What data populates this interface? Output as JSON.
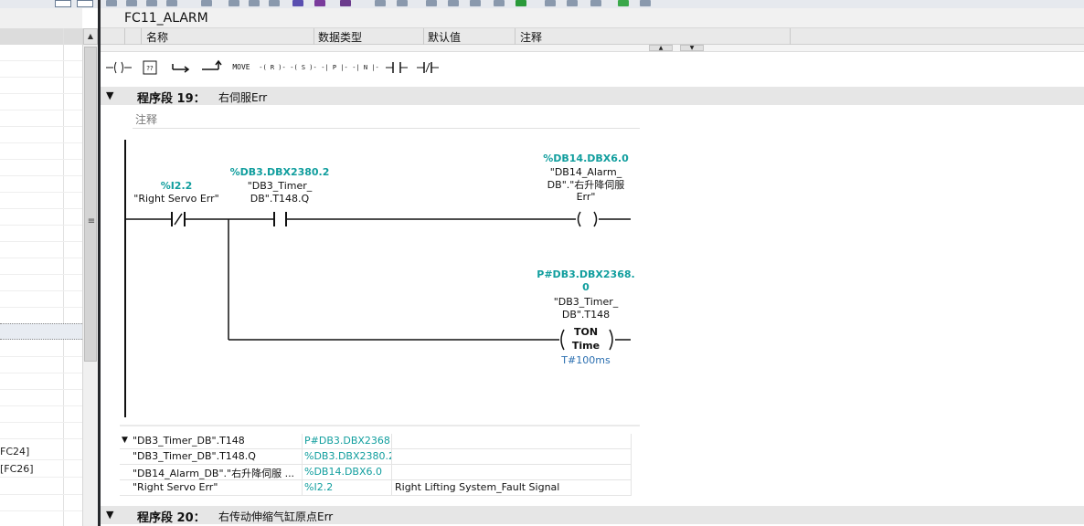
{
  "left_tree": {
    "items": [
      {
        "label": ""
      },
      {
        "label": ""
      },
      {
        "label": "FC24]"
      },
      {
        "label": "[FC26]"
      }
    ]
  },
  "block": {
    "title": "FC11_ALARM"
  },
  "interface": {
    "columns": [
      "名称",
      "数据类型",
      "默认值",
      "注释"
    ]
  },
  "palette": {
    "items": [
      {
        "icon": "coil-icon",
        "glyph": "—( )—"
      },
      {
        "icon": "empty-box-icon",
        "glyph": "??"
      },
      {
        "icon": "open-branch-icon",
        "glyph": "↦"
      },
      {
        "icon": "close-branch-icon",
        "glyph": "⮥"
      },
      {
        "icon": "move-icon",
        "glyph": "MOVE"
      },
      {
        "icon": "reset-coil-icon",
        "glyph": "-(R)-"
      },
      {
        "icon": "set-coil-icon",
        "glyph": "-(S)-"
      },
      {
        "icon": "pos-edge-icon",
        "glyph": "-|P|-"
      },
      {
        "icon": "neg-edge-icon",
        "glyph": "-|N|-"
      },
      {
        "icon": "no-contact-icon",
        "glyph": "-| |-"
      },
      {
        "icon": "nc-contact-icon",
        "glyph": "-|/|-"
      }
    ]
  },
  "network19": {
    "label": "程序段 19：",
    "title": "右伺服Err",
    "comment_label": "注释",
    "contact1": {
      "address": "%I2.2",
      "symbol": "\"Right Servo Err\""
    },
    "contact2": {
      "address": "%DB3.DBX2380.2",
      "symbol1": "\"DB3_Timer_",
      "symbol2": "DB\".T148.Q"
    },
    "coil": {
      "address": "%DB14.DBX6.0",
      "symbol1": "\"DB14_Alarm_",
      "symbol2": "DB\".\"右升降伺服",
      "symbol3": "Err\""
    },
    "timer": {
      "address1": "P#DB3.DBX2368.",
      "address2": "0",
      "symbol1": "\"DB3_Timer_",
      "symbol2": "DB\".T148",
      "type": "TON",
      "mode": "Time",
      "preset": "T#100ms"
    }
  },
  "var_table": {
    "rows": [
      {
        "name": "\"DB3_Timer_DB\".T148",
        "address": "P#DB3.DBX2368...",
        "comment": ""
      },
      {
        "name": "\"DB3_Timer_DB\".T148.Q",
        "address": "%DB3.DBX2380.2",
        "comment": ""
      },
      {
        "name": "\"DB14_Alarm_DB\".\"右升降伺服 ...",
        "address": "%DB14.DBX6.0",
        "comment": ""
      },
      {
        "name": "\"Right Servo Err\"",
        "address": "%I2.2",
        "comment": "Right Lifting System_Fault Signal"
      }
    ]
  },
  "network20": {
    "label": "程序段 20：",
    "title": "右传动伸缩气缸原点Err"
  },
  "colors": {
    "address": "#119e9e",
    "time_value": "#2b6fb0",
    "divider": "#26282c"
  }
}
